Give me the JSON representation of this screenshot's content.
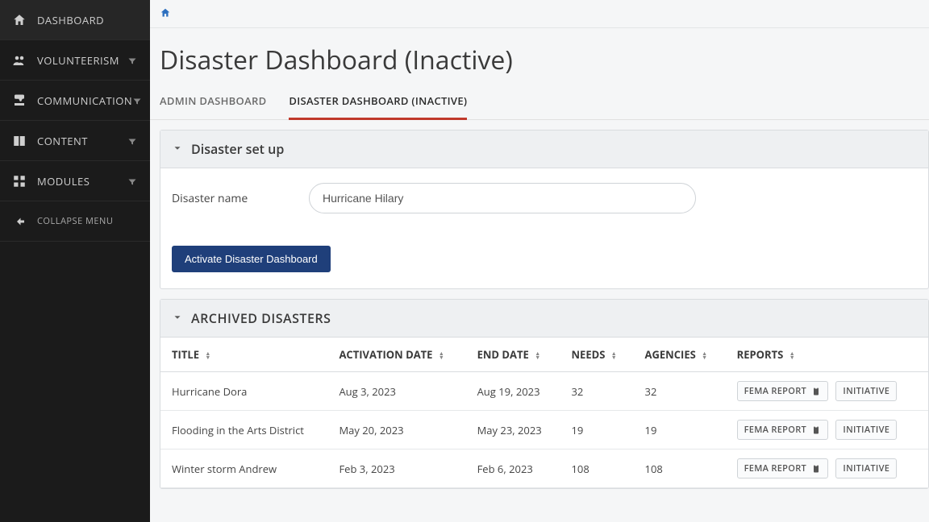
{
  "sidebar": {
    "items": [
      {
        "label": "DASHBOARD",
        "icon": "home",
        "has_filter": false
      },
      {
        "label": "VOLUNTEERISM",
        "icon": "people",
        "has_filter": true
      },
      {
        "label": "COMMUNICATION",
        "icon": "phone",
        "has_filter": true
      },
      {
        "label": "CONTENT",
        "icon": "book",
        "has_filter": true
      },
      {
        "label": "MODULES",
        "icon": "grid",
        "has_filter": true
      }
    ],
    "collapse_label": "COLLAPSE MENU"
  },
  "breadcrumb": {
    "home": "Home"
  },
  "page_title": "Disaster Dashboard (Inactive)",
  "tabs": [
    {
      "label": "ADMIN DASHBOARD",
      "active": false
    },
    {
      "label": "DISASTER DASHBOARD (INACTIVE)",
      "active": true
    }
  ],
  "setup_panel": {
    "title": "Disaster set up",
    "field_label": "Disaster name",
    "field_value": "Hurricane Hilary",
    "activate_button": "Activate Disaster Dashboard"
  },
  "archived_panel": {
    "title": "ARCHIVED DISASTERS",
    "columns": {
      "title": "TITLE",
      "activation_date": "ACTIVATION DATE",
      "end_date": "END DATE",
      "needs": "NEEDS",
      "agencies": "AGENCIES",
      "reports": "REPORTS"
    },
    "report_buttons": {
      "fema": "FEMA REPORT",
      "initiative": "INITIATIVE"
    },
    "rows": [
      {
        "title": "Hurricane Dora",
        "activation_date": "Aug 3, 2023",
        "end_date": "Aug 19, 2023",
        "needs": "32",
        "agencies": "32"
      },
      {
        "title": "Flooding in the Arts District",
        "activation_date": "May 20, 2023",
        "end_date": "May 23, 2023",
        "needs": "19",
        "agencies": "19"
      },
      {
        "title": "Winter storm Andrew",
        "activation_date": "Feb 3, 2023",
        "end_date": "Feb 6, 2023",
        "needs": "108",
        "agencies": "108"
      }
    ]
  },
  "colors": {
    "accent_red": "#c0392b",
    "primary_button": "#1f3f7a",
    "link": "#2d6fbf"
  }
}
